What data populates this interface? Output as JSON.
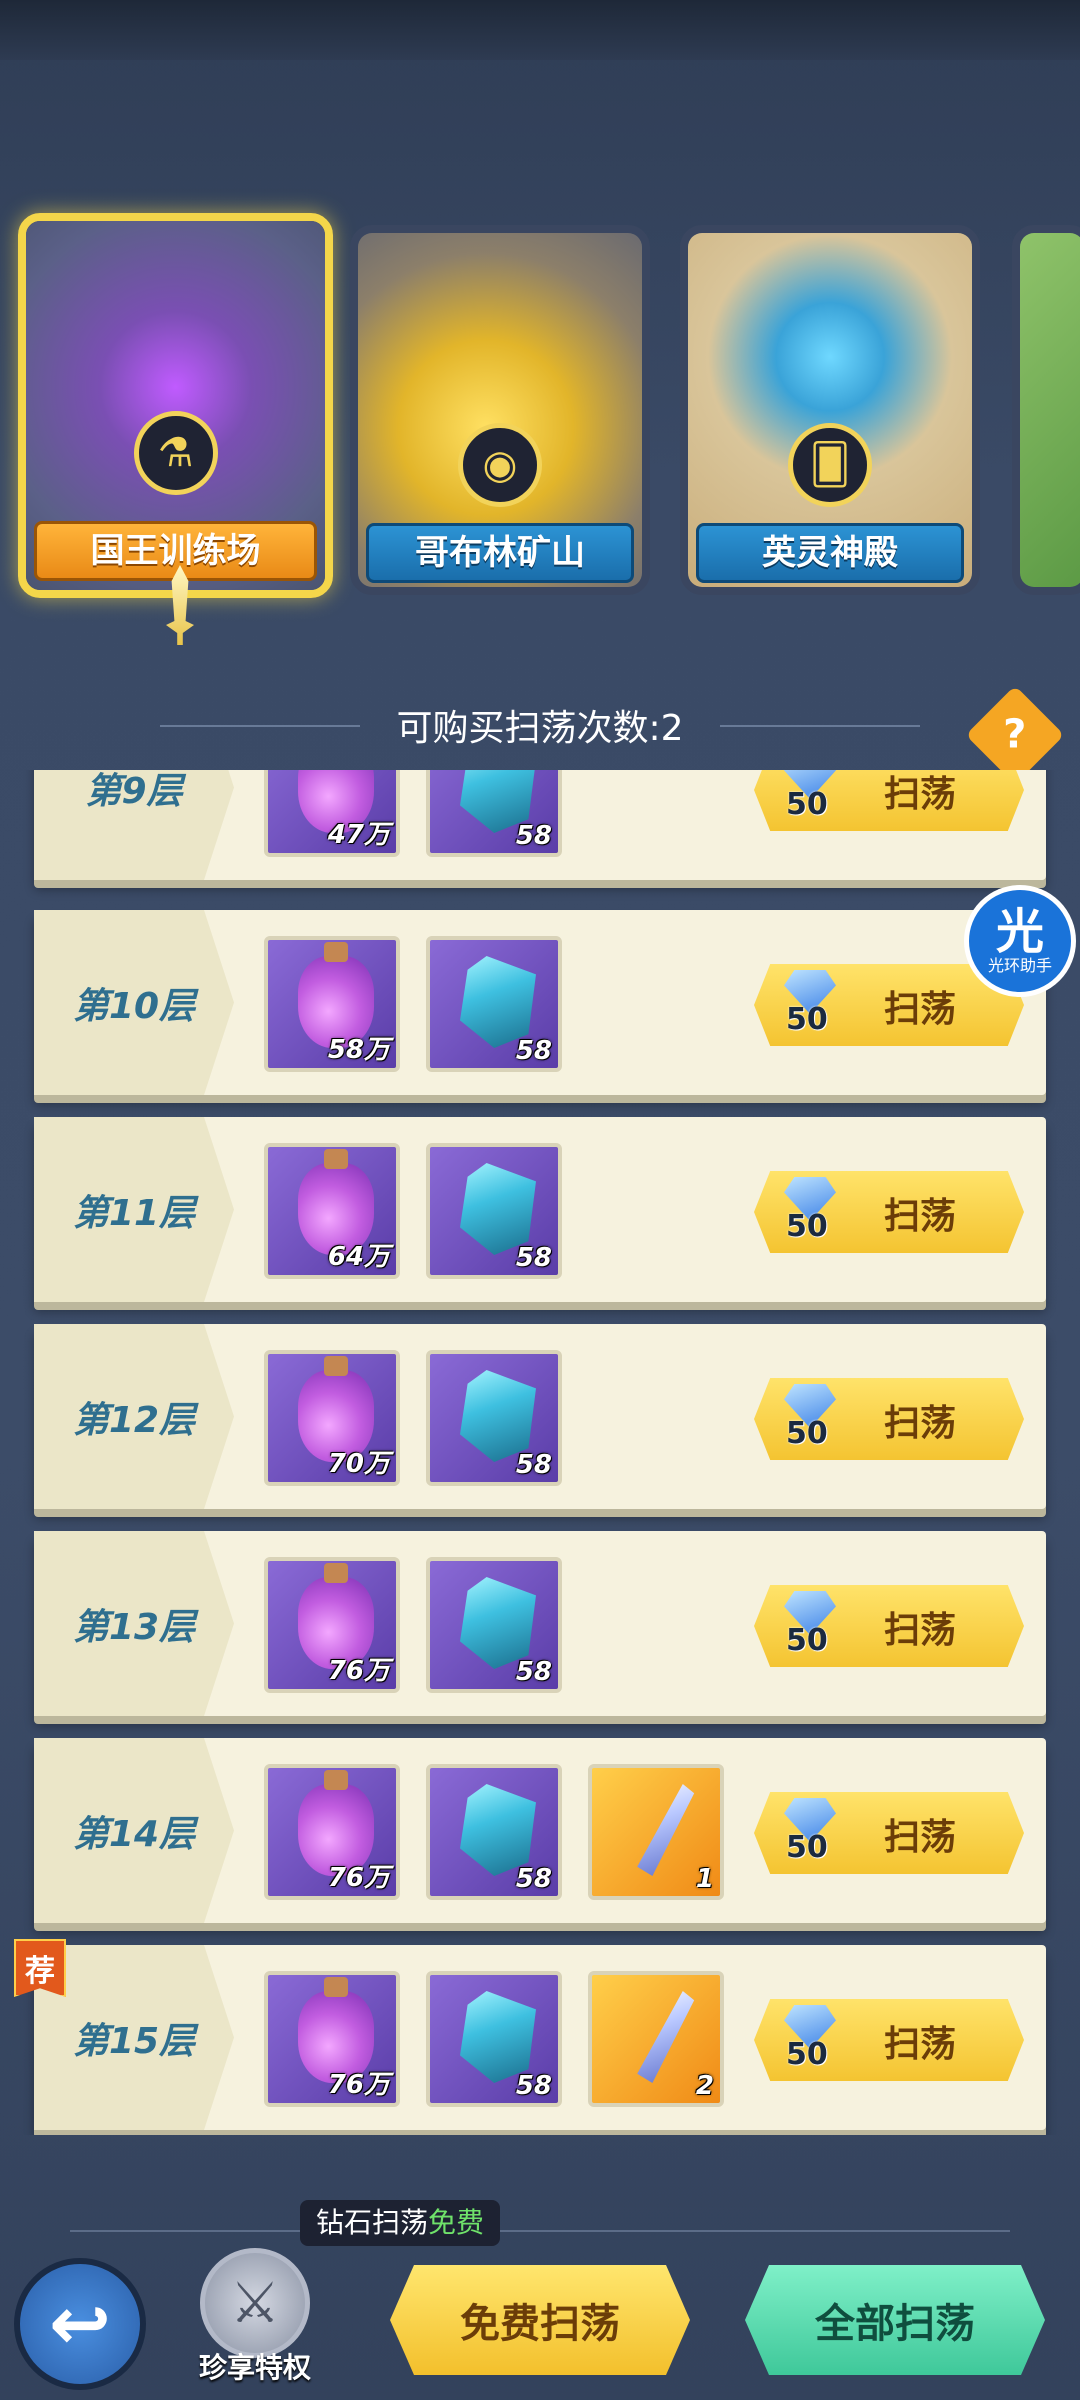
{
  "modes": [
    {
      "label": "国王训练场",
      "active": true
    },
    {
      "label": "哥布林矿山",
      "active": false
    },
    {
      "label": "英灵神殿",
      "active": false
    }
  ],
  "sweep": {
    "buy_count_text": "可购买扫荡次数:2",
    "help_icon": "?"
  },
  "assistant": {
    "big": "光",
    "small": "光环助手"
  },
  "floors": [
    {
      "label": "第9层",
      "potion": "47万",
      "crystal": "58",
      "cost": "50",
      "button": "扫荡"
    },
    {
      "label": "第10层",
      "potion": "58万",
      "crystal": "58",
      "cost": "50",
      "button": "扫荡"
    },
    {
      "label": "第11层",
      "potion": "64万",
      "crystal": "58",
      "cost": "50",
      "button": "扫荡"
    },
    {
      "label": "第12层",
      "potion": "70万",
      "crystal": "58",
      "cost": "50",
      "button": "扫荡"
    },
    {
      "label": "第13层",
      "potion": "76万",
      "crystal": "58",
      "cost": "50",
      "button": "扫荡"
    },
    {
      "label": "第14层",
      "potion": "76万",
      "crystal": "58",
      "shard": "1",
      "cost": "50",
      "button": "扫荡"
    },
    {
      "label": "第15层",
      "potion": "76万",
      "crystal": "58",
      "shard": "2",
      "cost": "50",
      "button": "扫荡",
      "tag": "荐"
    }
  ],
  "bottom": {
    "back_icon": "↩",
    "privilege_label": "珍享特权",
    "tooltip_prefix": "钻石扫荡",
    "tooltip_free": "免费",
    "free_sweep": "免费扫荡",
    "all_sweep": "全部扫荡"
  },
  "colors": {
    "accent_gold": "#f4c431",
    "accent_green": "#3fc89a",
    "floor_text": "#2f6f8f"
  }
}
